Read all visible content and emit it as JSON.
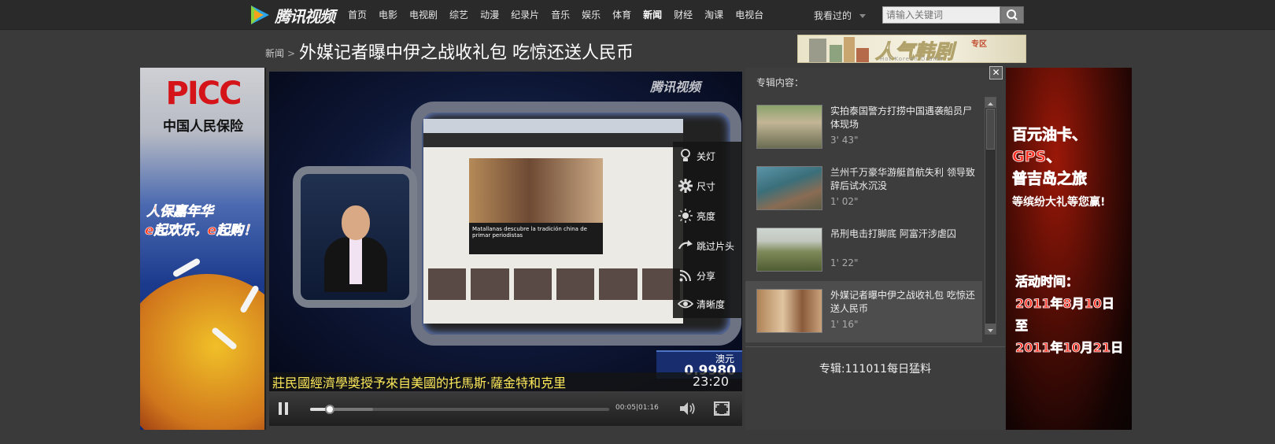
{
  "nav": {
    "logo_text": "腾讯视频",
    "links": [
      "首页",
      "电影",
      "电视剧",
      "综艺",
      "动漫",
      "纪录片",
      "音乐",
      "娱乐",
      "体育",
      "新闻",
      "财经",
      "淘课",
      "电视台"
    ],
    "active_link": "新闻",
    "history_label": "我看过的",
    "search_placeholder": "请输入关键词",
    "search_icon": "magnifier-icon"
  },
  "header": {
    "breadcrumb": "新闻",
    "breadcrumb_sep": ">",
    "title": "外媒记者曝中伊之战收礼包 吃惊还送人民币"
  },
  "ads": {
    "top_banner": {
      "text": "人气韩剧",
      "tag": "专区",
      "subtext": "Hot Korean Drama"
    },
    "left": {
      "brand": "PICC",
      "name": "中国人民保险",
      "slogan_1": "人保嘉年华",
      "slogan_2": "e起欢乐，e起购！"
    },
    "right": {
      "lines": [
        "百元油卡、",
        "GPS、",
        "普吉岛之旅"
      ],
      "sub": "等缤纷大礼等您赢!",
      "time_label": "活动时间：",
      "date_1": "2011年8月10日",
      "to": "至",
      "date_2": "2011年10月21日"
    }
  },
  "player": {
    "watermark": "腾讯视频",
    "ticker_currency": "澳元",
    "ticker_value": "0.9980",
    "ticker_clock": "23:20",
    "crawl": "莊民國經濟學獎授予來自美國的托馬斯·薩金特和克里",
    "web_caption": "Matallanas descubre la tradición china de primar periodistas",
    "menu": [
      {
        "icon": "bulb-icon",
        "label": "关灯"
      },
      {
        "icon": "gear-icon",
        "label": "尺寸"
      },
      {
        "icon": "sun-icon",
        "label": "亮度"
      },
      {
        "icon": "skip-icon",
        "label": "跳过片头"
      },
      {
        "icon": "share-icon",
        "label": "分享"
      },
      {
        "icon": "eye-icon",
        "label": "清晰度"
      }
    ],
    "time": "00:05|01:16",
    "progress_fraction": 0.066,
    "buffered_fraction": 0.21
  },
  "panel": {
    "heading": "专辑内容：",
    "close_symbol": "✕",
    "items": [
      {
        "title": "实拍泰国警方打捞中国遇袭船员尸体现场",
        "duration": "3' 43\"",
        "active": false
      },
      {
        "title": "兰州千万豪华游艇首航失利 领导致辞后试水沉没",
        "duration": "1' 02\"",
        "active": false
      },
      {
        "title": "吊刑电击打脚底 阿富汗涉虐囚",
        "duration": "1' 22\"",
        "active": false
      },
      {
        "title": "外媒记者曝中伊之战收礼包 吃惊还送人民币",
        "duration": "1' 16\"",
        "active": true
      }
    ],
    "album": "专辑:111011每日猛料"
  },
  "colors": {
    "page_bg": "#3a3a3a",
    "nav_bg": "#2a2a2a",
    "panel_bg": "#3d3d3d",
    "ticker_bg": "#172d6d",
    "crawl_text": "#ffeb5a",
    "picc_red": "#d41418",
    "right_ad_red": "#ff2d20"
  }
}
